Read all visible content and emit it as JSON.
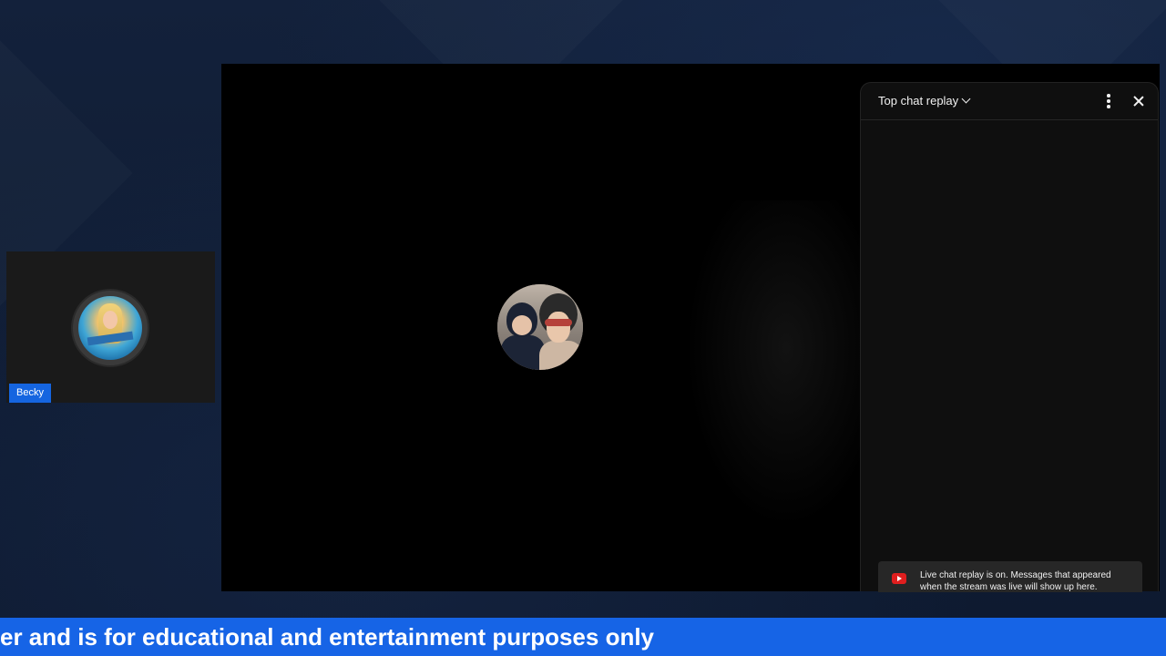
{
  "guest": {
    "name": "Becky",
    "avatar_icon": "guest-avatar"
  },
  "host": {
    "avatar_icon": "host-avatar"
  },
  "chat": {
    "title": "Top chat replay",
    "title_icon": "chevron-down-icon",
    "menu_icon": "more-vert-icon",
    "close_icon": "close-icon",
    "notice_icon": "youtube-icon",
    "notice_text": "Live chat replay is on. Messages that appeared when the stream was live will show up here."
  },
  "ticker": {
    "text": "er and is for educational and entertainment purposes only"
  },
  "colors": {
    "background": "#0f1c33",
    "ticker": "#1664e6",
    "name_tag": "#1565e0",
    "chat_bg": "#0f0f0f",
    "youtube_red": "#e01e1e"
  }
}
